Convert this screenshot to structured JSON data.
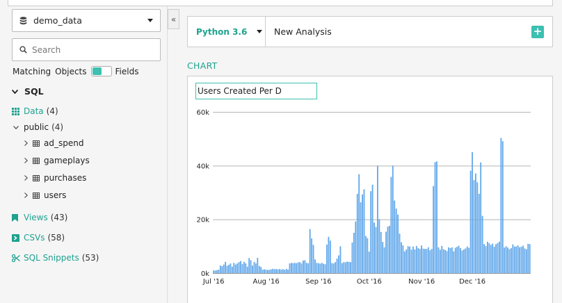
{
  "sidebar": {
    "database": "demo_data",
    "collapse_glyph": "«",
    "search_placeholder": "Search",
    "match_label": "Matching",
    "objects_label": "Objects",
    "fields_label": "Fields",
    "sql_label": "SQL",
    "data_label": "Data",
    "data_count": "(4)",
    "schema_label": "public",
    "schema_count": "(4)",
    "tables": [
      "ad_spend",
      "gameplays",
      "purchases",
      "users"
    ],
    "views_label": "Views",
    "views_count": "(43)",
    "csvs_label": "CSVs",
    "csvs_count": "(58)",
    "snippets_label": "SQL Snippets",
    "snippets_count": "(53)"
  },
  "cell": {
    "language": "Python 3.6",
    "title": "New Analysis",
    "add_glyph": "+"
  },
  "chart_section_label": "CHART",
  "chart_title_input": "Users Created Per D",
  "colors": {
    "accent": "#1ea28f",
    "bar": "#62a8ea"
  },
  "chart_data": {
    "type": "bar",
    "xlabel": "",
    "ylabel": "",
    "ylim": [
      0,
      60000
    ],
    "y_ticks": [
      "0k",
      "20k",
      "40k",
      "60k"
    ],
    "x_ticks": [
      "Jul '16",
      "Aug '16",
      "Sep '16",
      "Oct '16",
      "Nov '16",
      "Dec '16"
    ],
    "start_date": "2016-07-01",
    "values": [
      1000,
      1000,
      1100,
      1300,
      2800,
      2600,
      3200,
      4200,
      2700,
      3100,
      3600,
      2400,
      3800,
      3200,
      3600,
      4100,
      4500,
      3400,
      4200,
      3600,
      2400,
      5600,
      4800,
      2800,
      4200,
      3600,
      5700,
      2700,
      2300,
      1300,
      1400,
      1300,
      1200,
      1200,
      1400,
      1600,
      1500,
      1500,
      1400,
      1500,
      1300,
      1500,
      1200,
      1600,
      1300,
      3600,
      3800,
      3700,
      3800,
      3700,
      4000,
      4100,
      3600,
      4700,
      4800,
      3800,
      3700,
      16400,
      12900,
      10500,
      5100,
      3800,
      3700,
      3500,
      3800,
      3500,
      3300,
      10600,
      13500,
      12100,
      3700,
      3600,
      4100,
      5400,
      6600,
      10000,
      3700,
      4100,
      4000,
      4300,
      4200,
      4100,
      11400,
      15000,
      19200,
      29500,
      36800,
      26400,
      29300,
      31200,
      13800,
      13000,
      8000,
      30500,
      32900,
      18800,
      17200,
      40000,
      20100,
      15300,
      11600,
      9600,
      15400,
      17300,
      17600,
      35800,
      40000,
      27000,
      24000,
      21800,
      14700,
      11500,
      10300,
      8100,
      8800,
      10000,
      9900,
      8700,
      9900,
      8800,
      10100,
      9300,
      9000,
      10300,
      9100,
      9000,
      9000,
      9600,
      8500,
      9000,
      32400,
      41300,
      41600,
      9600,
      8700,
      10100,
      8900,
      8600,
      8200,
      9600,
      9300,
      9600,
      8100,
      9400,
      9800,
      10200,
      9300,
      8400,
      8800,
      9200,
      9900,
      9400,
      38100,
      45000,
      34600,
      37100,
      33800,
      29500,
      41200,
      21300,
      10800,
      10100,
      11700,
      11100,
      10500,
      11000,
      9800,
      10800,
      11200,
      11700,
      50300,
      49100,
      9500,
      10000,
      9500,
      8900,
      9300,
      10700,
      9900,
      9900,
      10300,
      9600,
      9800,
      10200,
      9200,
      8900,
      10900,
      10800
    ]
  }
}
